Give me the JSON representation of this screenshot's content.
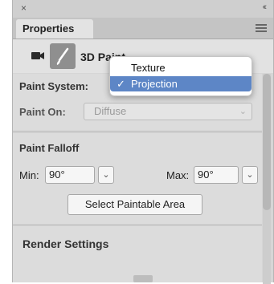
{
  "window": {
    "close_glyph": "×",
    "collapse_glyph": "‹‹"
  },
  "tab": {
    "label": "Properties"
  },
  "toolbar": {
    "mode_label": "3D Paint",
    "camera_icon": "camera-icon",
    "brush_icon": "paintbrush-icon"
  },
  "paint_system": {
    "label": "Paint System:"
  },
  "paint_on": {
    "label": "Paint On:",
    "value": "Diffuse"
  },
  "paint_falloff": {
    "heading": "Paint Falloff",
    "min_label": "Min:",
    "min_value": "90°",
    "max_label": "Max:",
    "max_value": "90°"
  },
  "select_paintable": {
    "label": "Select Paintable Area"
  },
  "render_settings": {
    "heading": "Render Settings"
  },
  "popup": {
    "items": [
      {
        "label": "Texture",
        "selected": false
      },
      {
        "label": "Projection",
        "selected": true
      }
    ],
    "check_glyph": "✓",
    "highlight_color": "#5d86c6"
  },
  "glyphs": {
    "chevron": "⌄"
  }
}
